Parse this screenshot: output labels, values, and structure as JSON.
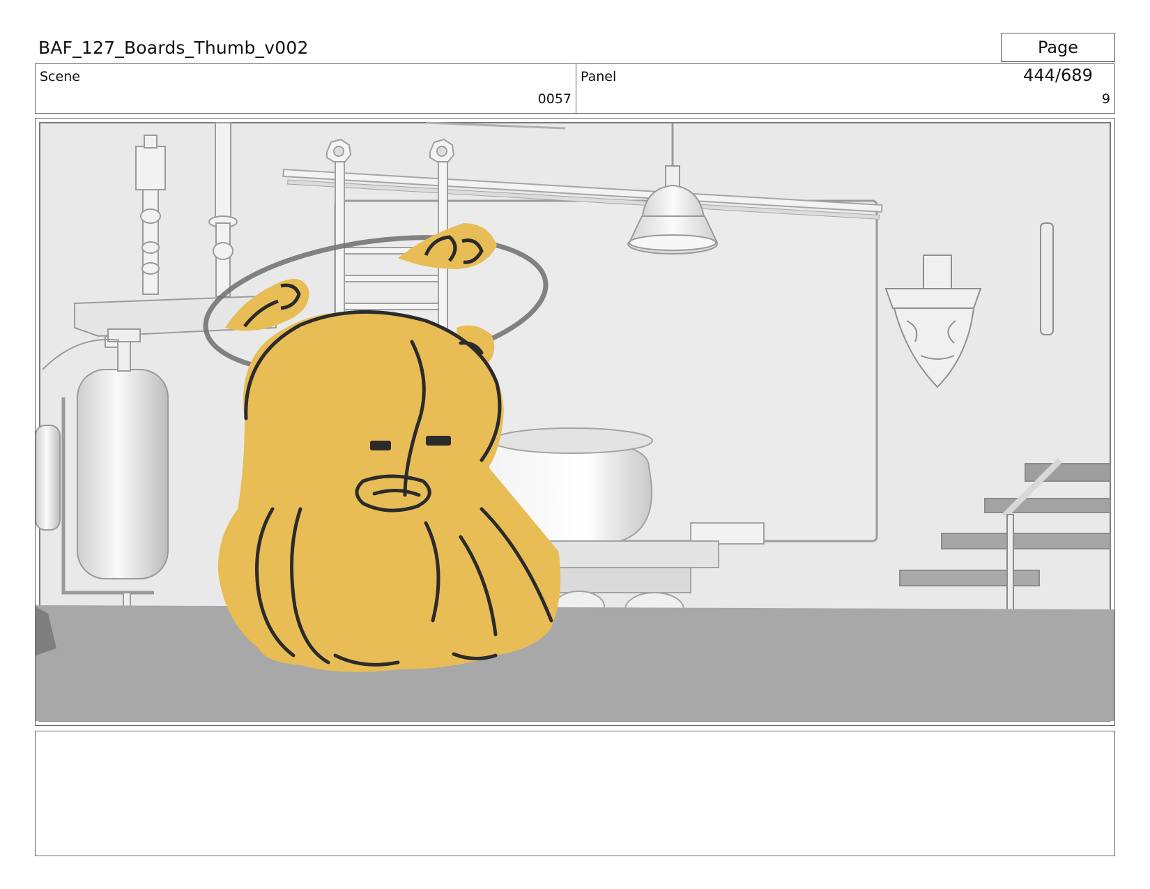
{
  "document": {
    "title": "BAF_127_Boards_Thumb_v002",
    "page_label": "Page 444/689"
  },
  "info": {
    "scene_label": "Scene",
    "scene_value": "0057",
    "panel_label": "Panel",
    "panel_value": "9"
  },
  "panel_image": {
    "description_icon": "storyboard-panel-image",
    "character_color": "#e8bd55",
    "set_color": "#e9e9e9",
    "floor_color": "#a8a8a8"
  },
  "notes": {
    "text": ""
  }
}
